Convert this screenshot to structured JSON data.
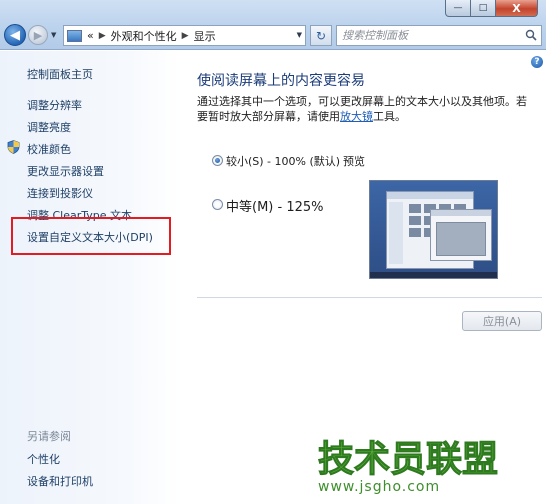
{
  "window": {
    "minimize_glyph": "—",
    "maximize_glyph": "□",
    "close_glyph": "X"
  },
  "nav": {
    "back_glyph": "◀",
    "forward_glyph": "▶",
    "dropdown_glyph": "▼"
  },
  "address": {
    "overflow": "«",
    "separator": "▶",
    "crumbs": [
      "外观和个性化",
      "显示"
    ],
    "refresh_glyph": "↻"
  },
  "search": {
    "placeholder": "搜索控制面板"
  },
  "sidebar": {
    "home": "控制面板主页",
    "items": [
      "调整分辨率",
      "调整亮度",
      "校准颜色",
      "更改显示器设置",
      "连接到投影仪",
      "调整 ClearType 文本",
      "设置自定义文本大小(DPI)"
    ],
    "see_also_title": "另请参阅",
    "see_also": [
      "个性化",
      "设备和打印机"
    ]
  },
  "main": {
    "help_glyph": "?",
    "title": "使阅读屏幕上的内容更容易",
    "description_part1": "通过选择其中一个选项，可以更改屏幕上的文本大小以及其他项。若要暂时放大部分屏幕，请使用",
    "description_link": "放大镜",
    "description_part2": "工具。",
    "options": [
      {
        "label": "较小(S) - 100% (默认)",
        "selected": true
      },
      {
        "label": "中等(M) - 125%",
        "selected": false
      }
    ],
    "preview_label": "预览",
    "apply_label": "应用(A)"
  },
  "watermark": {
    "text": "技术员联盟",
    "url": "www.jsgho.com"
  },
  "colors": {
    "link": "#1e3f66",
    "title": "#1c3d7a",
    "highlight": "#e31b23",
    "watermark": "#3e8f2c"
  }
}
